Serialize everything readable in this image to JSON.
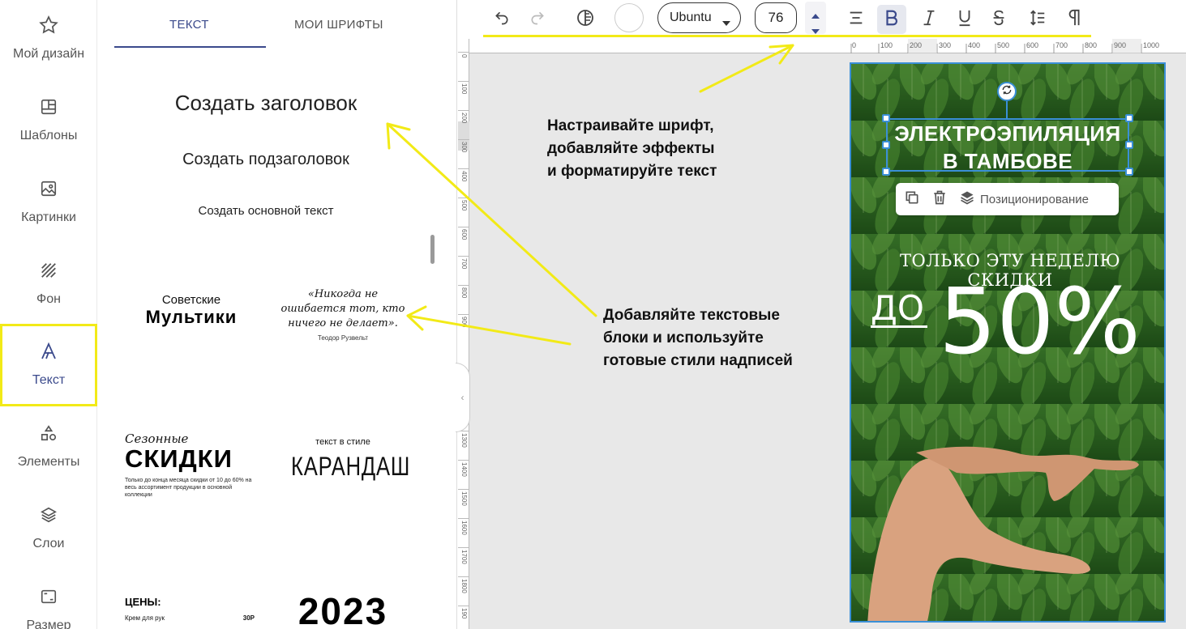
{
  "sidebar": {
    "items": [
      {
        "label": "Мой дизайн",
        "icon": "star-icon"
      },
      {
        "label": "Шаблоны",
        "icon": "templates-icon"
      },
      {
        "label": "Картинки",
        "icon": "image-icon"
      },
      {
        "label": "Фон",
        "icon": "background-icon"
      },
      {
        "label": "Текст",
        "icon": "text-icon"
      },
      {
        "label": "Элементы",
        "icon": "shapes-icon"
      },
      {
        "label": "Слои",
        "icon": "layers-icon"
      },
      {
        "label": "Размер",
        "icon": "resize-icon"
      }
    ]
  },
  "panel": {
    "tabs": [
      "ТЕКСТ",
      "МОИ ШРИФТЫ"
    ],
    "create_heading": "Создать заголовок",
    "create_subheading": "Создать подзаголовок",
    "create_body": "Создать основной текст",
    "templates": {
      "soviet_small": "Советские",
      "soviet_big": "Мультики",
      "quote": "«Никогда не ошибается тот, кто ничего не делает».",
      "quote_author": "Теодор Рузвельт",
      "season_small": "Сезонные",
      "season_big": "СКИДКИ",
      "season_note": "Только до конца месяца скидки от 10 до 60% на весь ассортимент продукции в основной коллекции",
      "pencil_small": "текст в стиле",
      "pencil_big": "КАРАНДАШ",
      "prices_title": "ЦЕНЫ:",
      "prices_item": "Крем для рук",
      "prices_value": "30Р",
      "year": "2023"
    }
  },
  "toolbar": {
    "font": "Ubuntu",
    "size": "76",
    "accent": "#f2ea17"
  },
  "ruler": {
    "top": [
      "0",
      "100",
      "200",
      "300",
      "400",
      "500",
      "600",
      "700",
      "800",
      "900",
      "1000"
    ],
    "left": [
      "0",
      "100",
      "200",
      "300",
      "400",
      "500",
      "600",
      "700",
      "800",
      "900",
      "1200",
      "1300",
      "1400",
      "1500",
      "1600",
      "1700",
      "1800",
      "190"
    ]
  },
  "annotations": {
    "top": [
      "Настраивайте шрифт,",
      "добавляйте эффекты",
      "и форматируйте текст"
    ],
    "middle": [
      "Добавляйте текстовые",
      "блоки и используйте",
      "готовые стили надписей"
    ]
  },
  "design": {
    "title_line1": "ЭЛЕКТРОЭПИЛЯЦИЯ",
    "title_line2": "В ТАМБОВЕ",
    "subtitle": "ТОЛЬКО ЭТУ НЕДЕЛЮ СКИДКИ",
    "prefix": "ДО",
    "percent": "50%",
    "position_button": "Позиционирование"
  }
}
